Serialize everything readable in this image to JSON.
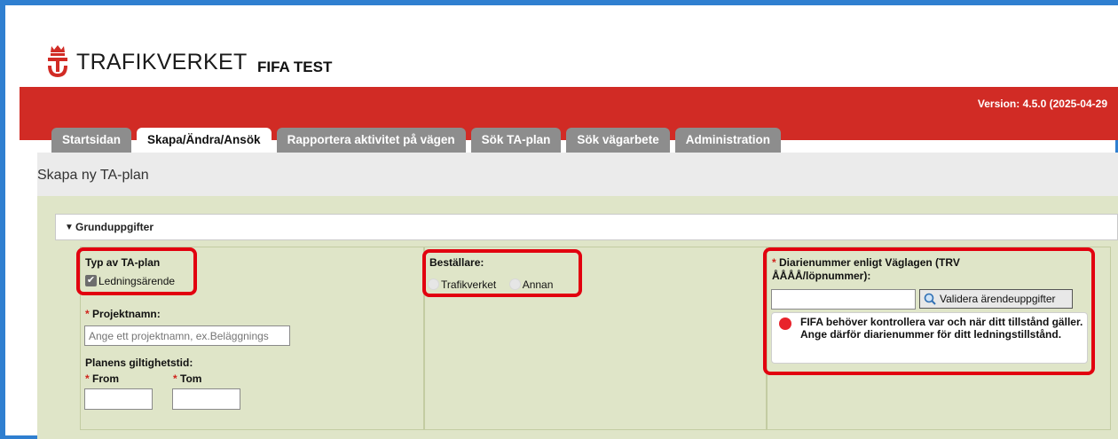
{
  "header": {
    "logo_text": "TRAFIKVERKET",
    "app_title": "FIFA TEST",
    "version": "Version: 4.5.0 (2025-04-29"
  },
  "tabs": [
    {
      "label": "Startsidan"
    },
    {
      "label": "Skapa/Ändra/Ansök",
      "active": true
    },
    {
      "label": "Rapportera aktivitet på vägen"
    },
    {
      "label": "Sök TA-plan"
    },
    {
      "label": "Sök vägarbete"
    },
    {
      "label": "Administration"
    }
  ],
  "page": {
    "title": "Skapa ny TA-plan"
  },
  "section": {
    "title": "Grunduppgifter",
    "expanded": true
  },
  "typ": {
    "label": "Typ av TA-plan",
    "checkbox_label": "Ledningsärende",
    "checked": true
  },
  "projekt": {
    "required_mark": "*",
    "label": "Projektnamn:",
    "placeholder": "Ange ett projektnamn, ex.Beläggnings"
  },
  "giltighet": {
    "label": "Planens giltighetstid:",
    "from_label": "From",
    "tom_label": "Tom",
    "required_mark": "*"
  },
  "bestallare": {
    "label": "Beställare:",
    "options": [
      "Trafikverket",
      "Annan"
    ]
  },
  "diarie": {
    "required_mark": "*",
    "label_line1": "Diarienummer enligt Väglagen (TRV",
    "label_line2": "ÅÅÅÅ/löpnummer):",
    "button_label": "Validera ärendeuppgifter",
    "alert_text": "FIFA behöver kontrollera var och när ditt tillstånd gäller. Ange därför diarienummer för ditt ledningstillstånd."
  },
  "colors": {
    "brand_red": "#d12b25",
    "highlight_red": "#e2000f",
    "tab_gray": "#8d8d8d",
    "panel_green": "#dfe5c8",
    "frame_blue": "#2f7fd0"
  }
}
